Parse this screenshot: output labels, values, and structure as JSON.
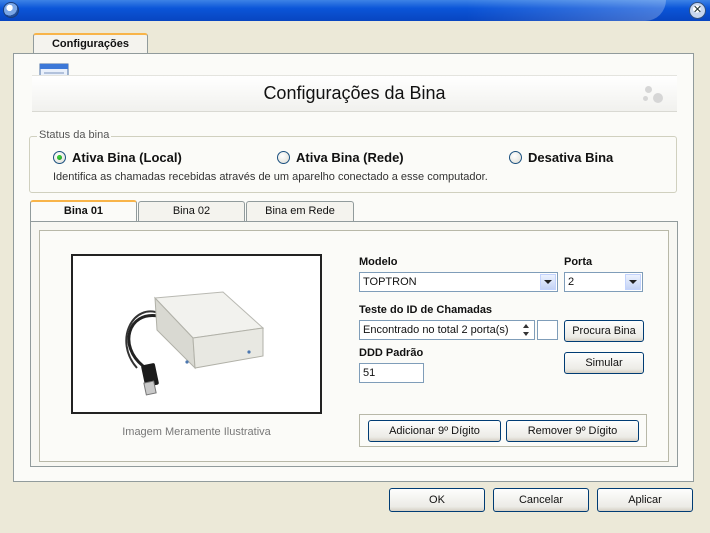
{
  "window": {
    "close_glyph": "✕"
  },
  "outer_tab": {
    "label": "Configurações"
  },
  "header": {
    "title": "Configurações da Bina"
  },
  "status": {
    "legend": "Status da bina",
    "options": [
      {
        "label": "Ativa Bina (Local)",
        "selected": true
      },
      {
        "label": "Ativa Bina (Rede)",
        "selected": false
      },
      {
        "label": "Desativa Bina",
        "selected": false
      }
    ],
    "description": "Identifica as chamadas recebidas através de um aparelho conectado a esse computador."
  },
  "inner_tabs": [
    {
      "label": "Bina 01",
      "active": true
    },
    {
      "label": "Bina 02",
      "active": false
    },
    {
      "label": "Bina em Rede",
      "active": false
    }
  ],
  "bina01": {
    "image_caption": "Imagem Meramente Ilustrativa",
    "modelo_label": "Modelo",
    "modelo_value": "TOPTRON",
    "porta_label": "Porta",
    "porta_value": "2",
    "teste_label": "Teste do ID de Chamadas",
    "teste_value": "Encontrado no total 2 porta(s)",
    "teste_extra": "",
    "procura_button": "Procura Bina",
    "simular_button": "Simular",
    "ddd_label": "DDD Padrão",
    "ddd_value": "51",
    "add_digit_button": "Adicionar 9º Dígito",
    "remove_digit_button": "Remover 9º Dígito"
  },
  "footer": {
    "ok": "OK",
    "cancel": "Cancelar",
    "apply": "Aplicar"
  }
}
